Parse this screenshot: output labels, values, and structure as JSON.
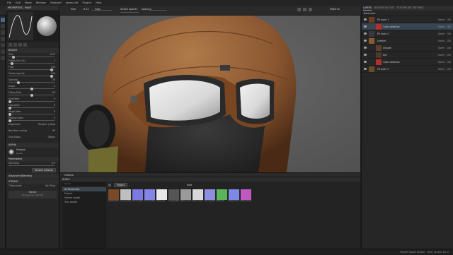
{
  "menu": [
    "File",
    "Edit",
    "Mode",
    "Window",
    "Viewport",
    "Javascript",
    "Plugins",
    "Help"
  ],
  "toolbar": {
    "size_label": "Size",
    "size_value": "6.22",
    "flow_label": "Flow",
    "flow_value": "100",
    "stroke_label": "Stroke opacity",
    "stroke_value": "100",
    "spacing_label": "Spacing",
    "spacing_value": "20",
    "material_mode": "Material"
  },
  "properties": {
    "title": "PROPERTIES - PAINT",
    "brush_section": "BRUSH",
    "rows": [
      {
        "label": "Size",
        "value": "6.22",
        "pos": 0.08
      },
      {
        "label": "Follow Size (%)",
        "value": "1",
        "pos": 0.05
      },
      {
        "label": "Flow",
        "value": "100",
        "pos": 0.95
      },
      {
        "label": "Stroke opacity",
        "value": "100",
        "pos": 0.95
      },
      {
        "label": "Spacing",
        "value": "20",
        "pos": 0.2
      },
      {
        "label": "Angle",
        "value": "0",
        "pos": 0.5
      },
      {
        "label": "Follow Path",
        "value": "Off",
        "pos": 0.5
      },
      {
        "label": "Size Jitter",
        "value": "0",
        "pos": 0.0
      },
      {
        "label": "Flow Jitter",
        "value": "0",
        "pos": 0.0
      },
      {
        "label": "Angle Jitter",
        "value": "0",
        "pos": 0.0
      },
      {
        "label": "Position Jitter",
        "value": "0",
        "pos": 0.0
      }
    ],
    "alignment_label": "Alignment",
    "alignment_value": "Tangent | Wrap",
    "backface_label": "Backface culling",
    "backface_value": "90",
    "size_space_label": "Size Space",
    "size_space_value": "Object",
    "alpha_section": "ALPHA",
    "alpha_name": "Shadow",
    "alpha_sub": "Global",
    "parameters_section": "Parameters",
    "hardness_label": "Hardness",
    "hardness_value": "0.5",
    "reset_label": "Restore defaults",
    "advanced_section": "Advanced Blending",
    "stencil_section": "STENCIL",
    "tiling_label": "Tiling mode",
    "tiling_value": "No Tiling",
    "stencil_name": "Stencil",
    "stencil_sub": "No Resource Selected"
  },
  "viewport": {
    "footer_label": "Material"
  },
  "shelf": {
    "title": "SHELF",
    "search_placeholder": "Search",
    "categories": [
      "All Resources",
      "Project",
      "Starter assets",
      "Your assets"
    ],
    "selected_category": 0,
    "filter_label": "Project",
    "tag_label": "Matt",
    "thumbs": [
      {
        "label": "Leather_Brown",
        "color": "#7a4a28"
      },
      {
        "label": "Grunge_Map_001",
        "color": "#bfbfbf"
      },
      {
        "label": "Normal_Map_01",
        "color": "#7a7ae0"
      },
      {
        "label": "Normal_Map_02",
        "color": "#8585e8"
      },
      {
        "label": "Baked_AO",
        "color": "#e8e8e8"
      },
      {
        "label": "Grunge_Map_013",
        "color": "#555555"
      },
      {
        "label": "Baked_Curvature",
        "color": "#9a9a9a"
      },
      {
        "label": "Baked_Thickness",
        "color": "#d8d8d8"
      },
      {
        "label": "Normal_Map_05",
        "color": "#8e8ee0"
      },
      {
        "label": "Baked_ID",
        "color": "#5ab55a"
      },
      {
        "label": "Baked_Normal",
        "color": "#7d8ae5"
      },
      {
        "label": "Baked_Position",
        "color": "#c05ac0"
      }
    ]
  },
  "layers": {
    "tabs": [
      "LAYERS",
      "TEXTURE SET LIST",
      "TEXTURE SET SETTINGS"
    ],
    "active_tab": 0,
    "texture_set_label": "Base color",
    "rows": [
      {
        "name": "Fill layer 1",
        "blend": "Norm",
        "opacity": "100",
        "sub": false,
        "thumb": "#6a3e20",
        "selected": false
      },
      {
        "name": "Color selection",
        "blend": "Norm",
        "opacity": "100",
        "sub": true,
        "thumb": "#b03030",
        "selected": true
      },
      {
        "name": "Fill layer 2",
        "blend": "Norm",
        "opacity": "100",
        "sub": false,
        "thumb": "#3a3a3a",
        "selected": false
      },
      {
        "name": "Leather",
        "blend": "Norm",
        "opacity": "100",
        "sub": false,
        "thumb": "#8a5a30",
        "selected": false
      },
      {
        "name": "Smooth",
        "blend": "Norm",
        "opacity": "100",
        "sub": true,
        "thumb": "#5a4030",
        "selected": false
      },
      {
        "name": "Dirt",
        "blend": "Norm",
        "opacity": "100",
        "sub": true,
        "thumb": "#4a3a2a",
        "selected": false
      },
      {
        "name": "Color selection",
        "blend": "Norm",
        "opacity": "100",
        "sub": true,
        "thumb": "#b03030",
        "selected": false
      },
      {
        "name": "Fill layer 3",
        "blend": "Norm",
        "opacity": "100",
        "sub": false,
        "thumb": "#6b4a2a",
        "selected": false
      }
    ]
  },
  "status": "Painter Stable Version · GPU | Version 8.1.2",
  "colors": {
    "accent": "#6aa0d8",
    "panel": "#262626",
    "viewport": "#5e5e5e"
  }
}
